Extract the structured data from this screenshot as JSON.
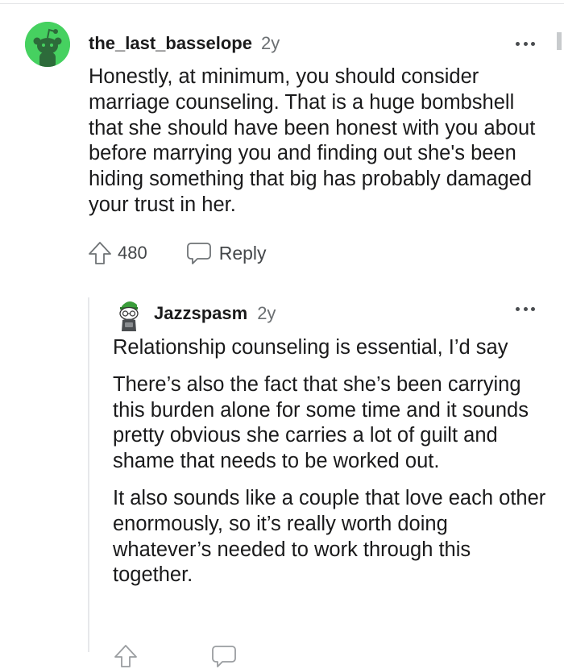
{
  "comment": {
    "username": "the_last_basselope",
    "age": "2y",
    "body": "Honestly, at minimum, you should consider marriage counseling. That is a huge bombshell that she should have been honest with you about before marrying you and finding out she's been hiding something that big has probably damaged your trust in her.",
    "upvotes": "480",
    "reply_label": "Reply",
    "avatar_color": "#46d160"
  },
  "reply": {
    "username": "Jazzspasm",
    "age": "2y",
    "paragraphs": [
      "Relationship counseling is essential, I’d say",
      "There’s also the fact that she’s been carrying this burden alone for some time and it sounds pretty obvious she carries a lot of guilt and shame that needs to be worked out.",
      "It also sounds like a couple that love each other enormously, so it’s really worth doing whatever’s needed to work through this together."
    ]
  },
  "icons": {
    "more": "more-options-icon",
    "upvote": "upvote-arrow-icon",
    "reply": "reply-bubble-icon"
  }
}
